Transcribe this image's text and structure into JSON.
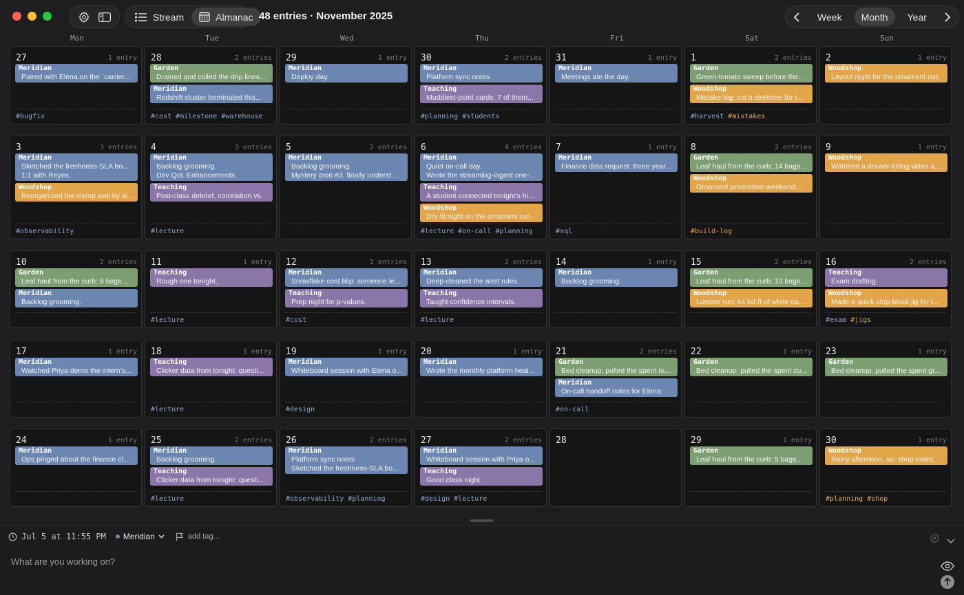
{
  "window": {
    "title": "48 entries · November 2025"
  },
  "toolbar": {
    "settings_icon": "gear-icon",
    "sidebar_icon": "sidebar-icon",
    "views": [
      {
        "label": "Stream",
        "icon": "list-icon",
        "active": false
      },
      {
        "label": "Almanac",
        "icon": "calendar-icon",
        "active": true
      }
    ],
    "range": {
      "options": [
        "Week",
        "Month",
        "Year"
      ],
      "active": "Month"
    }
  },
  "colors": {
    "Meridian": "#6b86b0",
    "Garden": "#7d9d72",
    "Teaching": "#8a76a8",
    "Woodshop": "#e3a54a",
    "tag_default": "#8fa7cc",
    "tag_woodshop": "#e3a54a"
  },
  "weekdays": [
    "Mon",
    "Tue",
    "Wed",
    "Thu",
    "Fri",
    "Sat",
    "Sun"
  ],
  "days": [
    {
      "num": "27",
      "count": "1 entry",
      "entries": [
        {
          "cat": "Meridian",
          "text": "Paired with Elena on the `carrier..."
        }
      ],
      "tags": [
        {
          "t": "#bugfix",
          "c": "tag_default"
        }
      ]
    },
    {
      "num": "28",
      "count": "2 entries",
      "entries": [
        {
          "cat": "Garden",
          "text": "Drained and coiled the drip lines..."
        },
        {
          "cat": "Meridian",
          "text": "Redshift cluster terminated this..."
        }
      ],
      "tags": [
        {
          "t": "#cost",
          "c": "tag_default"
        },
        {
          "t": "#milestone",
          "c": "tag_default"
        },
        {
          "t": "#warehouse",
          "c": "tag_default"
        }
      ]
    },
    {
      "num": "29",
      "count": "1 entry",
      "entries": [
        {
          "cat": "Meridian",
          "text": "Deploy day."
        }
      ],
      "tags": []
    },
    {
      "num": "30",
      "count": "2 entries",
      "entries": [
        {
          "cat": "Meridian",
          "text": "Platform sync notes"
        },
        {
          "cat": "Teaching",
          "text": "Muddiest-point cards: 7 of them..."
        }
      ],
      "tags": [
        {
          "t": "#planning",
          "c": "tag_default"
        },
        {
          "t": "#students",
          "c": "tag_default"
        }
      ]
    },
    {
      "num": "31",
      "count": "1 entry",
      "entries": [
        {
          "cat": "Meridian",
          "text": "Meetings ate the day."
        }
      ],
      "tags": []
    },
    {
      "num": "1",
      "count": "2 entries",
      "entries": [
        {
          "cat": "Garden",
          "text": "Green-tomato sweep before the..."
        },
        {
          "cat": "Woodshop",
          "text": "Mistake log: cut a stretcher for t..."
        }
      ],
      "tags": [
        {
          "t": "#harvest",
          "c": "tag_default"
        },
        {
          "t": "#mistakes",
          "c": "tag_woodshop"
        }
      ]
    },
    {
      "num": "2",
      "count": "1 entry",
      "entries": [
        {
          "cat": "Woodshop",
          "text": "Layout night for the ornament run."
        }
      ],
      "tags": []
    },
    {
      "num": "3",
      "count": "3 entries",
      "entries": [
        {
          "cat": "Meridian",
          "text": "Sketched the freshness-SLA bo...",
          "text2": "1:1 with Reyes."
        },
        {
          "cat": "Woodshop",
          "text": "Reorganized the clamp wall by si..."
        }
      ],
      "tags": [
        {
          "t": "#observability",
          "c": "tag_default"
        }
      ]
    },
    {
      "num": "4",
      "count": "3 entries",
      "entries": [
        {
          "cat": "Meridian",
          "text": "Backlog grooming.",
          "text2": "Dev QoL Enhancements."
        },
        {
          "cat": "Teaching",
          "text": "Post-class debrief, correlation vs."
        }
      ],
      "tags": [
        {
          "t": "#lecture",
          "c": "tag_default"
        }
      ]
    },
    {
      "num": "5",
      "count": "2 entries",
      "entries": [
        {
          "cat": "Meridian",
          "text": "Backlog grooming.",
          "text2": "Mystery cron #3, finally underst..."
        }
      ],
      "tags": []
    },
    {
      "num": "6",
      "count": "4 entries",
      "entries": [
        {
          "cat": "Meridian",
          "text": "Quiet on-call day.",
          "text2": "Wrote the streaming-ingest one-..."
        },
        {
          "cat": "Teaching",
          "text": "A student connected tonight's hi..."
        },
        {
          "cat": "Woodshop",
          "text": "Dry-fit night on the ornament run."
        }
      ],
      "tags": [
        {
          "t": "#lecture",
          "c": "tag_default"
        },
        {
          "t": "#on-call",
          "c": "tag_default"
        },
        {
          "t": "#planning",
          "c": "tag_default"
        }
      ]
    },
    {
      "num": "7",
      "count": "1 entry",
      "entries": [
        {
          "cat": "Meridian",
          "text": "Finance data request: three year..."
        }
      ],
      "tags": [
        {
          "t": "#sql",
          "c": "tag_default"
        }
      ]
    },
    {
      "num": "8",
      "count": "2 entries",
      "entries": [
        {
          "cat": "Garden",
          "text": "Leaf haul from the curb: 14 bags..."
        },
        {
          "cat": "Woodshop",
          "text": "Ornament production weekend:..."
        }
      ],
      "tags": [
        {
          "t": "#build-log",
          "c": "tag_woodshop"
        }
      ]
    },
    {
      "num": "9",
      "count": "1 entry",
      "entries": [
        {
          "cat": "Woodshop",
          "text": "Watched a drawer-fitting video a..."
        }
      ],
      "tags": []
    },
    {
      "num": "10",
      "count": "2 entries",
      "entries": [
        {
          "cat": "Garden",
          "text": "Leaf haul from the curb: 8 bags..."
        },
        {
          "cat": "Meridian",
          "text": "Backlog grooming."
        }
      ],
      "tags": []
    },
    {
      "num": "11",
      "count": "1 entry",
      "entries": [
        {
          "cat": "Teaching",
          "text": "Rough one tonight."
        }
      ],
      "tags": [
        {
          "t": "#lecture",
          "c": "tag_default"
        }
      ]
    },
    {
      "num": "12",
      "count": "2 entries",
      "entries": [
        {
          "cat": "Meridian",
          "text": "Snowflake cost blip: someone le..."
        },
        {
          "cat": "Teaching",
          "text": "Prep night for p-values."
        }
      ],
      "tags": [
        {
          "t": "#cost",
          "c": "tag_default"
        }
      ]
    },
    {
      "num": "13",
      "count": "2 entries",
      "entries": [
        {
          "cat": "Meridian",
          "text": "Deep-cleaned the alert rules."
        },
        {
          "cat": "Teaching",
          "text": "Taught confidence intervals."
        }
      ],
      "tags": [
        {
          "t": "#lecture",
          "c": "tag_default"
        }
      ]
    },
    {
      "num": "14",
      "count": "1 entry",
      "entries": [
        {
          "cat": "Meridian",
          "text": "Backlog grooming."
        }
      ],
      "tags": []
    },
    {
      "num": "15",
      "count": "2 entries",
      "entries": [
        {
          "cat": "Garden",
          "text": "Leaf haul from the curb: 10 bags..."
        },
        {
          "cat": "Woodshop",
          "text": "Lumber run: 44 bd-ft of white oa..."
        }
      ],
      "tags": []
    },
    {
      "num": "16",
      "count": "2 entries",
      "entries": [
        {
          "cat": "Teaching",
          "text": "Exam drafting."
        },
        {
          "cat": "Woodshop",
          "text": "Made a quick stop-block jig for r..."
        }
      ],
      "tags": [
        {
          "t": "#exam",
          "c": "tag_default"
        },
        {
          "t": "#jigs",
          "c": "tag_woodshop"
        }
      ]
    },
    {
      "num": "17",
      "count": "1 entry",
      "entries": [
        {
          "cat": "Meridian",
          "text": "Watched Priya demo the intern's..."
        }
      ],
      "tags": []
    },
    {
      "num": "18",
      "count": "1 entry",
      "entries": [
        {
          "cat": "Teaching",
          "text": "Clicker data from tonight: questi..."
        }
      ],
      "tags": [
        {
          "t": "#lecture",
          "c": "tag_default"
        }
      ]
    },
    {
      "num": "19",
      "count": "1 entry",
      "entries": [
        {
          "cat": "Meridian",
          "text": "Whiteboard session with Elena o..."
        }
      ],
      "tags": [
        {
          "t": "#design",
          "c": "tag_default"
        }
      ]
    },
    {
      "num": "20",
      "count": "1 entry",
      "entries": [
        {
          "cat": "Meridian",
          "text": "Wrote the monthly platform heal..."
        }
      ],
      "tags": []
    },
    {
      "num": "21",
      "count": "2 entries",
      "entries": [
        {
          "cat": "Garden",
          "text": "Bed cleanup: pulled the spent to..."
        },
        {
          "cat": "Meridian",
          "text": "On-call handoff notes for Elena:"
        }
      ],
      "tags": [
        {
          "t": "#on-call",
          "c": "tag_default"
        }
      ]
    },
    {
      "num": "22",
      "count": "1 entry",
      "entries": [
        {
          "cat": "Garden",
          "text": "Bed cleanup: pulled the spent cu..."
        }
      ],
      "tags": []
    },
    {
      "num": "23",
      "count": "1 entry",
      "entries": [
        {
          "cat": "Garden",
          "text": "Bed cleanup: pulled the spent gr..."
        }
      ],
      "tags": []
    },
    {
      "num": "24",
      "count": "1 entry",
      "entries": [
        {
          "cat": "Meridian",
          "text": "Ops pinged about the finance cl..."
        }
      ],
      "tags": []
    },
    {
      "num": "25",
      "count": "2 entries",
      "entries": [
        {
          "cat": "Meridian",
          "text": "Backlog grooming."
        },
        {
          "cat": "Teaching",
          "text": "Clicker data from tonight: questi..."
        }
      ],
      "tags": [
        {
          "t": "#lecture",
          "c": "tag_default"
        }
      ]
    },
    {
      "num": "26",
      "count": "2 entries",
      "entries": [
        {
          "cat": "Meridian",
          "text": "Platform sync notes",
          "text2": "Sketched the freshness-SLA bo..."
        }
      ],
      "tags": [
        {
          "t": "#observability",
          "c": "tag_default"
        },
        {
          "t": "#planning",
          "c": "tag_default"
        }
      ]
    },
    {
      "num": "27",
      "count": "2 entries",
      "entries": [
        {
          "cat": "Meridian",
          "text": "Whiteboard session with Priya o..."
        },
        {
          "cat": "Teaching",
          "text": "Good class night."
        }
      ],
      "tags": [
        {
          "t": "#design",
          "c": "tag_default"
        },
        {
          "t": "#lecture",
          "c": "tag_default"
        }
      ]
    },
    {
      "num": "28",
      "count": "",
      "entries": [],
      "tags": []
    },
    {
      "num": "29",
      "count": "1 entry",
      "entries": [
        {
          "cat": "Garden",
          "text": "Leaf haul from the curb: 5 bags..."
        }
      ],
      "tags": []
    },
    {
      "num": "30",
      "count": "1 entry",
      "entries": [
        {
          "cat": "Woodshop",
          "text": "Rainy afternoon, so: shop maint..."
        }
      ],
      "tags": [
        {
          "t": "#planning",
          "c": "tag_woodshop"
        },
        {
          "t": "#shop",
          "c": "tag_woodshop"
        }
      ]
    }
  ],
  "composer": {
    "timestamp": "Jul 5 at 11:55 PM",
    "project": "Meridian",
    "add_tag": "add tag...",
    "placeholder": "What are you working on?"
  }
}
